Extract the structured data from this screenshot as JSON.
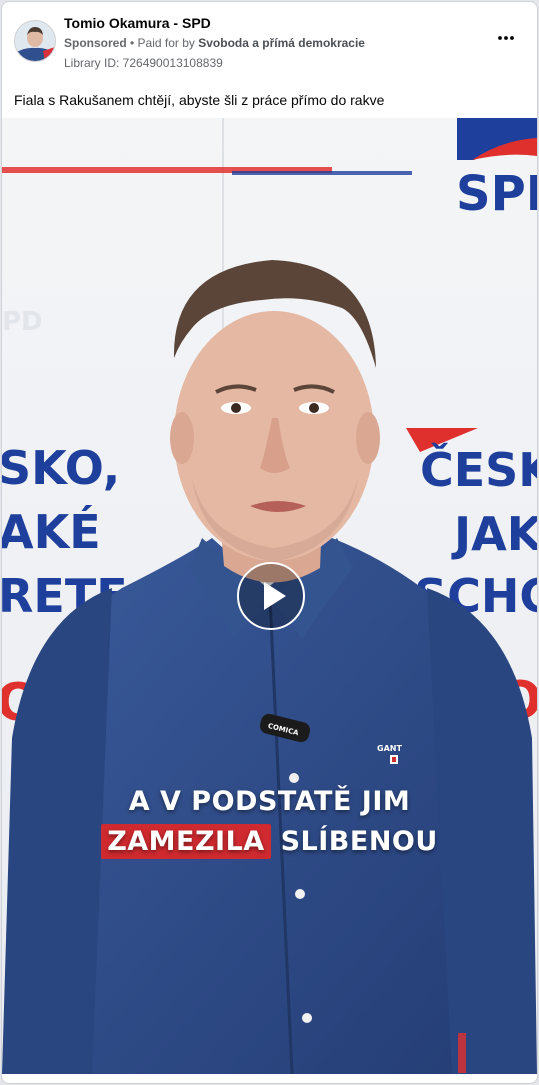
{
  "post": {
    "page_name": "Tomio Okamura - SPD",
    "sponsored_label": "Sponsored",
    "paid_for_text": " • Paid for by ",
    "payer": "Svoboda a přímá demokracie",
    "library_id": "Library ID: 726490013108839",
    "caption": "Fiala s Rakušanem chtějí, abyste šli z práce přímo do rakve"
  },
  "video": {
    "logo_text": "SPD",
    "mic_label": "COMICA",
    "shirt_brand": "GANT",
    "bg_left_lines": [
      "SKO,",
      "AKÉ",
      "RETE"
    ],
    "bg_right_lines": [
      "ČESK",
      "JAK",
      "SCHC"
    ],
    "subtitle_line1": "A V PODSTATĚ JIM",
    "subtitle_highlight": "ZAMEZILA",
    "subtitle_rest": " SLÍBENOU"
  },
  "colors": {
    "spd_blue": "#1f3f9c",
    "spd_red": "#e0302e",
    "shirt_blue": "#2e4a86",
    "highlight_red": "#cf2a2f"
  },
  "icons": {
    "more": "three-dots-icon",
    "play": "play-icon"
  }
}
